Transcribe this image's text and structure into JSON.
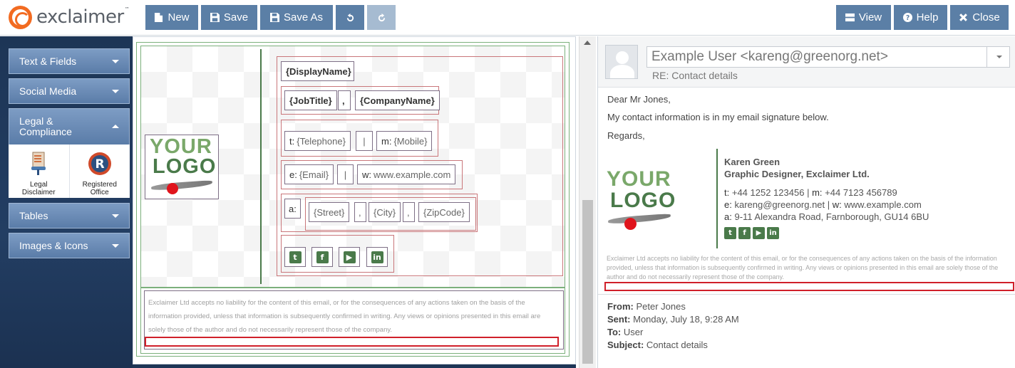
{
  "app": {
    "brand": "exclaimer",
    "trademark": "™"
  },
  "toolbar": {
    "new_label": "New",
    "save_label": "Save",
    "save_as_label": "Save As",
    "view_label": "View",
    "help_label": "Help",
    "close_label": "Close"
  },
  "sidebar": {
    "sections": [
      {
        "label": "Text & Fields"
      },
      {
        "label": "Social Media"
      },
      {
        "label": "Legal & Compliance",
        "expanded": true
      },
      {
        "label": "Tables"
      },
      {
        "label": "Images & Icons"
      }
    ],
    "legal_items": [
      {
        "label": "Legal Disclaimer",
        "icon": "legal-disclaimer-icon"
      },
      {
        "label": "Registered Office",
        "icon": "registered-office-icon"
      }
    ]
  },
  "editor": {
    "logo_line1": "YOUR",
    "logo_line2": "LOGO",
    "display_name": "{DisplayName}",
    "job_title": "{JobTitle}",
    "comma": ",",
    "company_name": "{CompanyName}",
    "tel_label": "t:",
    "telephone": "{Telephone}",
    "separator": "|",
    "mobile_label": "m:",
    "mobile": "{Mobile}",
    "email_label": "e:",
    "email": "{Email}",
    "web_label": "w:",
    "website": "www.example.com",
    "addr_label": "a:",
    "street": "{Street}",
    "city": "{City}",
    "zip": "{ZipCode}",
    "social": [
      "twitter-icon",
      "facebook-icon",
      "youtube-icon",
      "linkedin-icon"
    ],
    "disclaimer": "Exclaimer Ltd accepts no liability for the content of this email, or for the consequences of any actions taken on the basis of the information provided, unless that information is subsequently confirmed in writing. Any views or opinions presented in this email are solely those of the author and do not necessarily represent those of the company."
  },
  "preview": {
    "from": "Example User <kareng@greenorg.net>",
    "subject": "RE: Contact details",
    "greeting": "Dear Mr Jones,",
    "body": "My contact information is in my email signature below.",
    "signoff": "Regards,",
    "sig_name": "Karen Green",
    "sig_title": "Graphic Designer, Exclaimer Ltd.",
    "t_label": "t:",
    "phone": "+44 1252 123456",
    "sep": "|",
    "m_label": "m:",
    "mobile": "+44 7123 456789",
    "e_label": "e:",
    "email": "kareng@greenorg.net",
    "w_label": "w:",
    "website": "www.example.com",
    "a_label": "a:",
    "address": "9-11 Alexandra Road, Farnborough, GU14 6BU",
    "disclaimer": "Exclaimer Ltd accepts no liability for the content of this email, or for the consequences of any actions taken on the basis of the information provided, unless that information is subsequently confirmed in writing. Any views or opinions presented in this email are solely those of the author and do not necessarily represent those of the company.",
    "meta": {
      "from_label": "From:",
      "from_value": "Peter Jones",
      "sent_label": "Sent:",
      "sent_value": "Monday, July 18, 9:28 AM",
      "to_label": "To:",
      "to_value": "User",
      "subject_label": "Subject:",
      "subject_value": "Contact details"
    }
  },
  "colors": {
    "accent": "#5b7fa6",
    "brand_green": "#4a7a4a",
    "logo_orange": "#f26b21",
    "highlight_red": "#d0202a"
  }
}
